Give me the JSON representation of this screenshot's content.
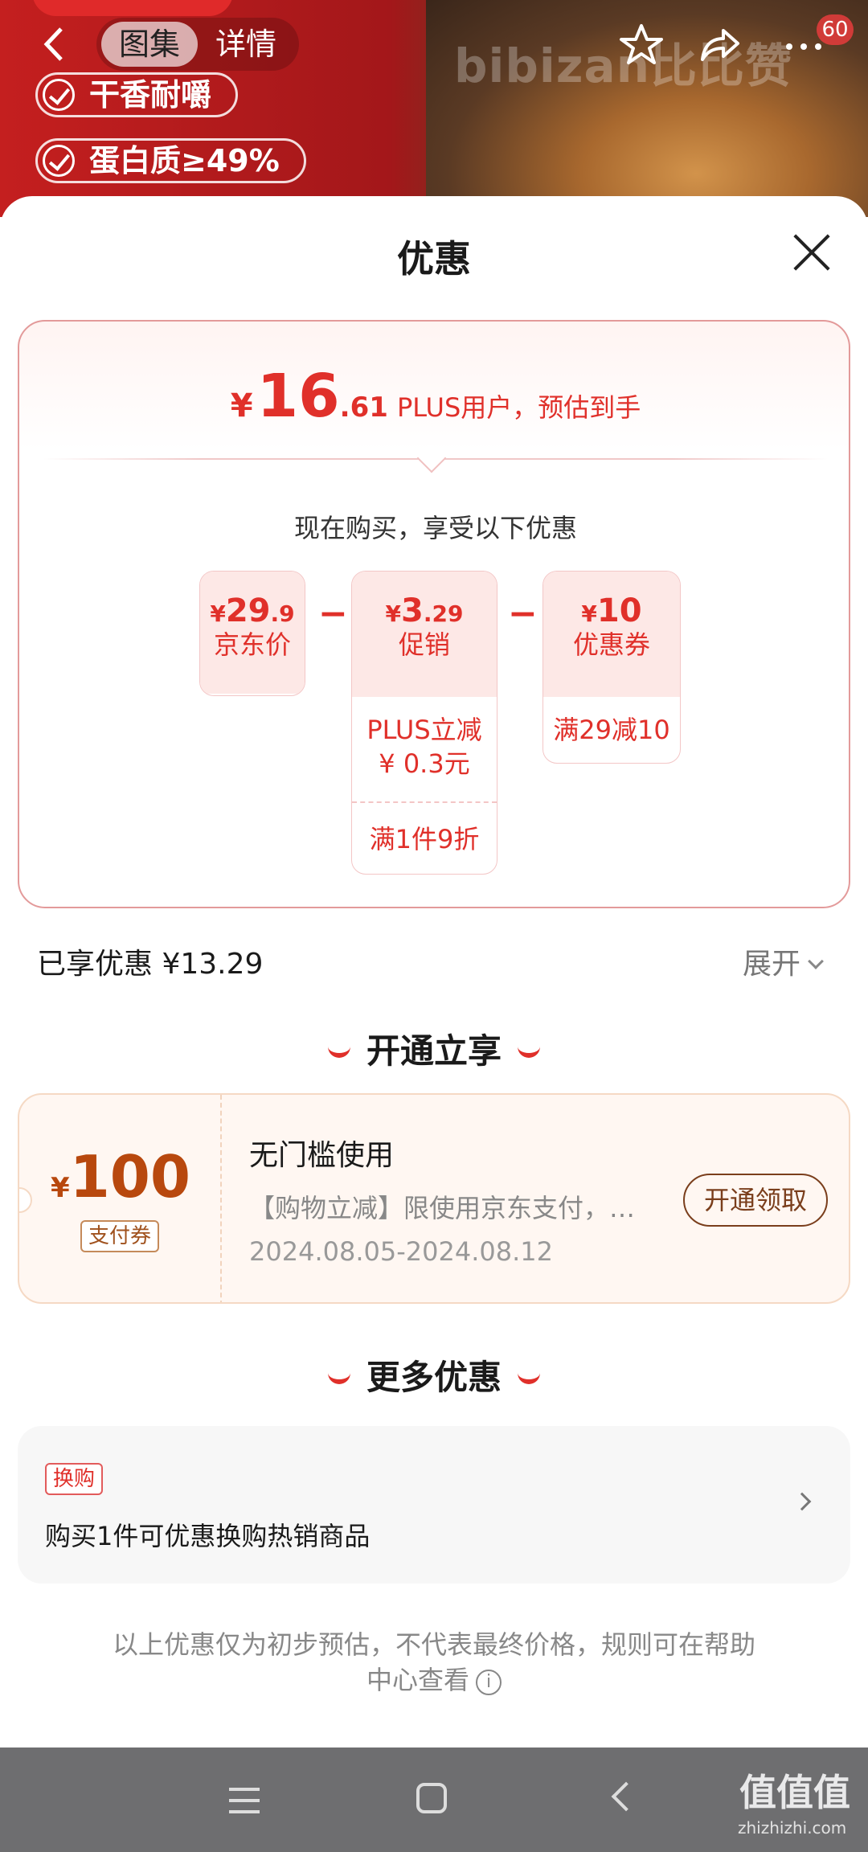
{
  "header": {
    "back_icon": "chevron-left-icon",
    "tabs": [
      "图集",
      "详情"
    ],
    "brand_watermark": "bibizan比比赞",
    "features": [
      "干香耐嚼",
      "蛋白质≥49%"
    ],
    "cart_count": "60"
  },
  "sheet": {
    "title": "优惠"
  },
  "estimate": {
    "symbol": "¥",
    "integer": "16",
    "decimal": ".61",
    "text": "PLUS用户，预估到手",
    "buy_now": "现在购买，享受以下优惠"
  },
  "breakdown": {
    "jd_price": {
      "symbol": "¥",
      "big": "29",
      "small": ".9",
      "label": "京东价"
    },
    "promo": {
      "symbol": "¥",
      "big": "3",
      "small": ".29",
      "label": "促销",
      "items": [
        "PLUS立减\n¥ 0.3元",
        "满1件9折"
      ]
    },
    "coupon": {
      "symbol": "¥",
      "big": "10",
      "small": "",
      "label": "优惠券",
      "items": [
        "满29减10"
      ]
    },
    "minus": "−"
  },
  "enjoyed": {
    "text": "已享优惠 ¥13.29",
    "expand": "展开"
  },
  "open_section": {
    "title": "开通立享",
    "coupon": {
      "symbol": "¥",
      "amount": "100",
      "tag": "支付券",
      "title": "无门槛使用",
      "desc": "【购物立减】限使用京东支付，…",
      "date": "2024.08.05-2024.08.12",
      "button": "开通领取"
    }
  },
  "more_section": {
    "title": "更多优惠",
    "tag": "换购",
    "desc": "购买1件可优惠换购热销商品"
  },
  "disclaimer": "以上优惠仅为初步预估，不代表最终价格，规则可在帮助中心查看",
  "watermark": {
    "main": "值值值",
    "sub": "zhizhizhi.com"
  },
  "colors": {
    "accent": "#e0302a",
    "coupon_brown": "#b8480e",
    "nav_bg": "#6e6e70"
  }
}
